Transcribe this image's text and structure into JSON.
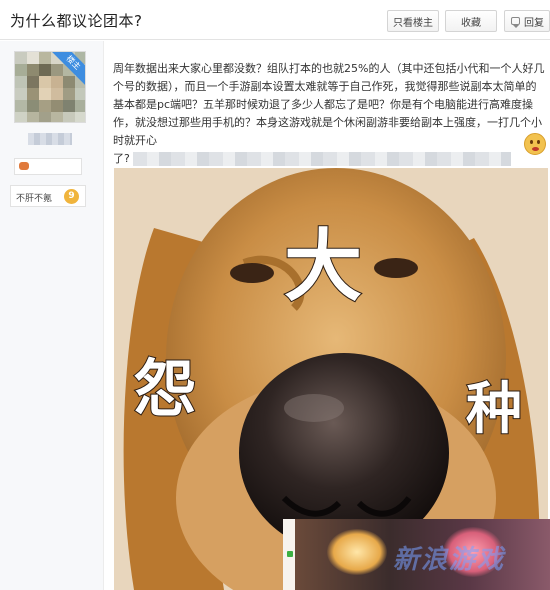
{
  "header": {
    "title": "为什么都议论团本?",
    "buttons": {
      "only_host": "只看楼主",
      "favorite": "收藏",
      "reply": "回复"
    }
  },
  "author": {
    "badge": "楼主",
    "forum": {
      "name": "不肝不氪",
      "level": "9"
    }
  },
  "post": {
    "text": "周年数据出来大家心里都没数？组队打本的也就25%的人（其中还包括小代和一个人好几个号的数据），而且一个手游副本设置太难就等于自己作死，我觉得那些说副本太简单的基本都是pc端吧？五羊那时候劝退了多少人都忘了是吧？你是有个电脑能进行高难度操作，就没想过那些用手机的？本身这游戏就是个休闲副游非要给副本上强度，一打几个小时就开心",
    "tail": "了?"
  },
  "meme": {
    "chars": [
      "大",
      "怨",
      "种"
    ]
  },
  "icons": {
    "reply": "reply-icon",
    "emoji": "angry-emoji-icon",
    "game": "game-controller-icon"
  }
}
